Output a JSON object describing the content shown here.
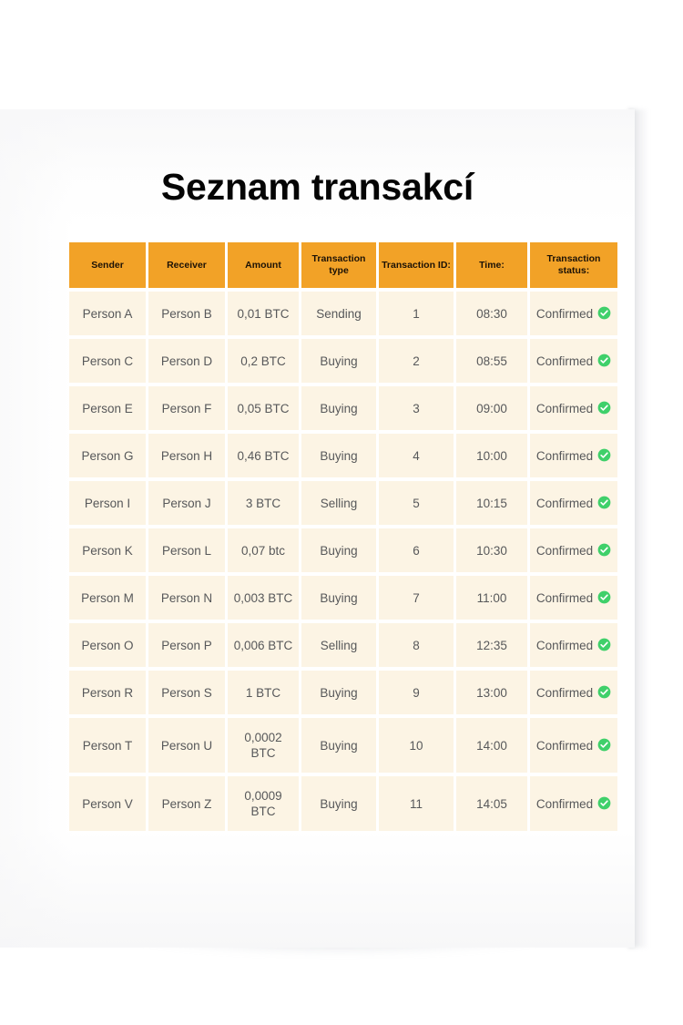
{
  "document": {
    "title": "Seznam transakcí"
  },
  "colors": {
    "header_background": "#f2a227",
    "header_text": "#1c1206",
    "cell_background": "#fcf4e4",
    "cell_text": "#57585a",
    "status_confirmed": "#3fd06a",
    "page_background": "#ffffff",
    "paper": "#ffffff"
  },
  "table": {
    "columns": [
      {
        "key": "sender",
        "label": "Sender"
      },
      {
        "key": "receiver",
        "label": "Receiver"
      },
      {
        "key": "amount",
        "label": "Amount"
      },
      {
        "key": "type",
        "label": "Transaction type"
      },
      {
        "key": "id",
        "label": "Transaction ID:"
      },
      {
        "key": "time",
        "label": "Time:"
      },
      {
        "key": "status",
        "label": "Transaction status:"
      }
    ],
    "rows": [
      {
        "sender": "Person A",
        "receiver": "Person B",
        "amount": "0,01 BTC",
        "type": "Sending",
        "id": "1",
        "time": "08:30",
        "status": "Confirmed",
        "status_icon": "check-circle-icon"
      },
      {
        "sender": "Person C",
        "receiver": "Person D",
        "amount": "0,2 BTC",
        "type": "Buying",
        "id": "2",
        "time": "08:55",
        "status": "Confirmed",
        "status_icon": "check-circle-icon"
      },
      {
        "sender": "Person E",
        "receiver": "Person F",
        "amount": "0,05 BTC",
        "type": "Buying",
        "id": "3",
        "time": "09:00",
        "status": "Confirmed",
        "status_icon": "check-circle-icon"
      },
      {
        "sender": "Person G",
        "receiver": "Person H",
        "amount": "0,46 BTC",
        "type": "Buying",
        "id": "4",
        "time": "10:00",
        "status": "Confirmed",
        "status_icon": "check-circle-icon"
      },
      {
        "sender": "Person I",
        "receiver": "Person J",
        "amount": "3 BTC",
        "type": "Selling",
        "id": "5",
        "time": "10:15",
        "status": "Confirmed",
        "status_icon": "check-circle-icon"
      },
      {
        "sender": "Person K",
        "receiver": "Person  L",
        "amount": "0,07 btc",
        "type": "Buying",
        "id": "6",
        "time": "10:30",
        "status": "Confirmed",
        "status_icon": "check-circle-icon"
      },
      {
        "sender": "Person M",
        "receiver": "Person N",
        "amount": "0,003 BTC",
        "type": "Buying",
        "id": "7",
        "time": "11:00",
        "status": "Confirmed",
        "status_icon": "check-circle-icon"
      },
      {
        "sender": "Person O",
        "receiver": "Person P",
        "amount": "0,006 BTC",
        "type": "Selling",
        "id": "8",
        "time": "12:35",
        "status": "Confirmed",
        "status_icon": "check-circle-icon"
      },
      {
        "sender": "Person R",
        "receiver": "Person S",
        "amount": "1  BTC",
        "type": "Buying",
        "id": "9",
        "time": "13:00",
        "status": "Confirmed",
        "status_icon": "check-circle-icon"
      },
      {
        "sender": "Person T",
        "receiver": "Person U",
        "amount": "0,0002 BTC",
        "type": "Buying",
        "id": "10",
        "time": "14:00",
        "status": "Confirmed",
        "status_icon": "check-circle-icon"
      },
      {
        "sender": "Person V",
        "receiver": "Person Z",
        "amount": "0,0009 BTC",
        "type": "Buying",
        "id": "11",
        "time": "14:05",
        "status": "Confirmed",
        "status_icon": "check-circle-icon"
      }
    ]
  }
}
